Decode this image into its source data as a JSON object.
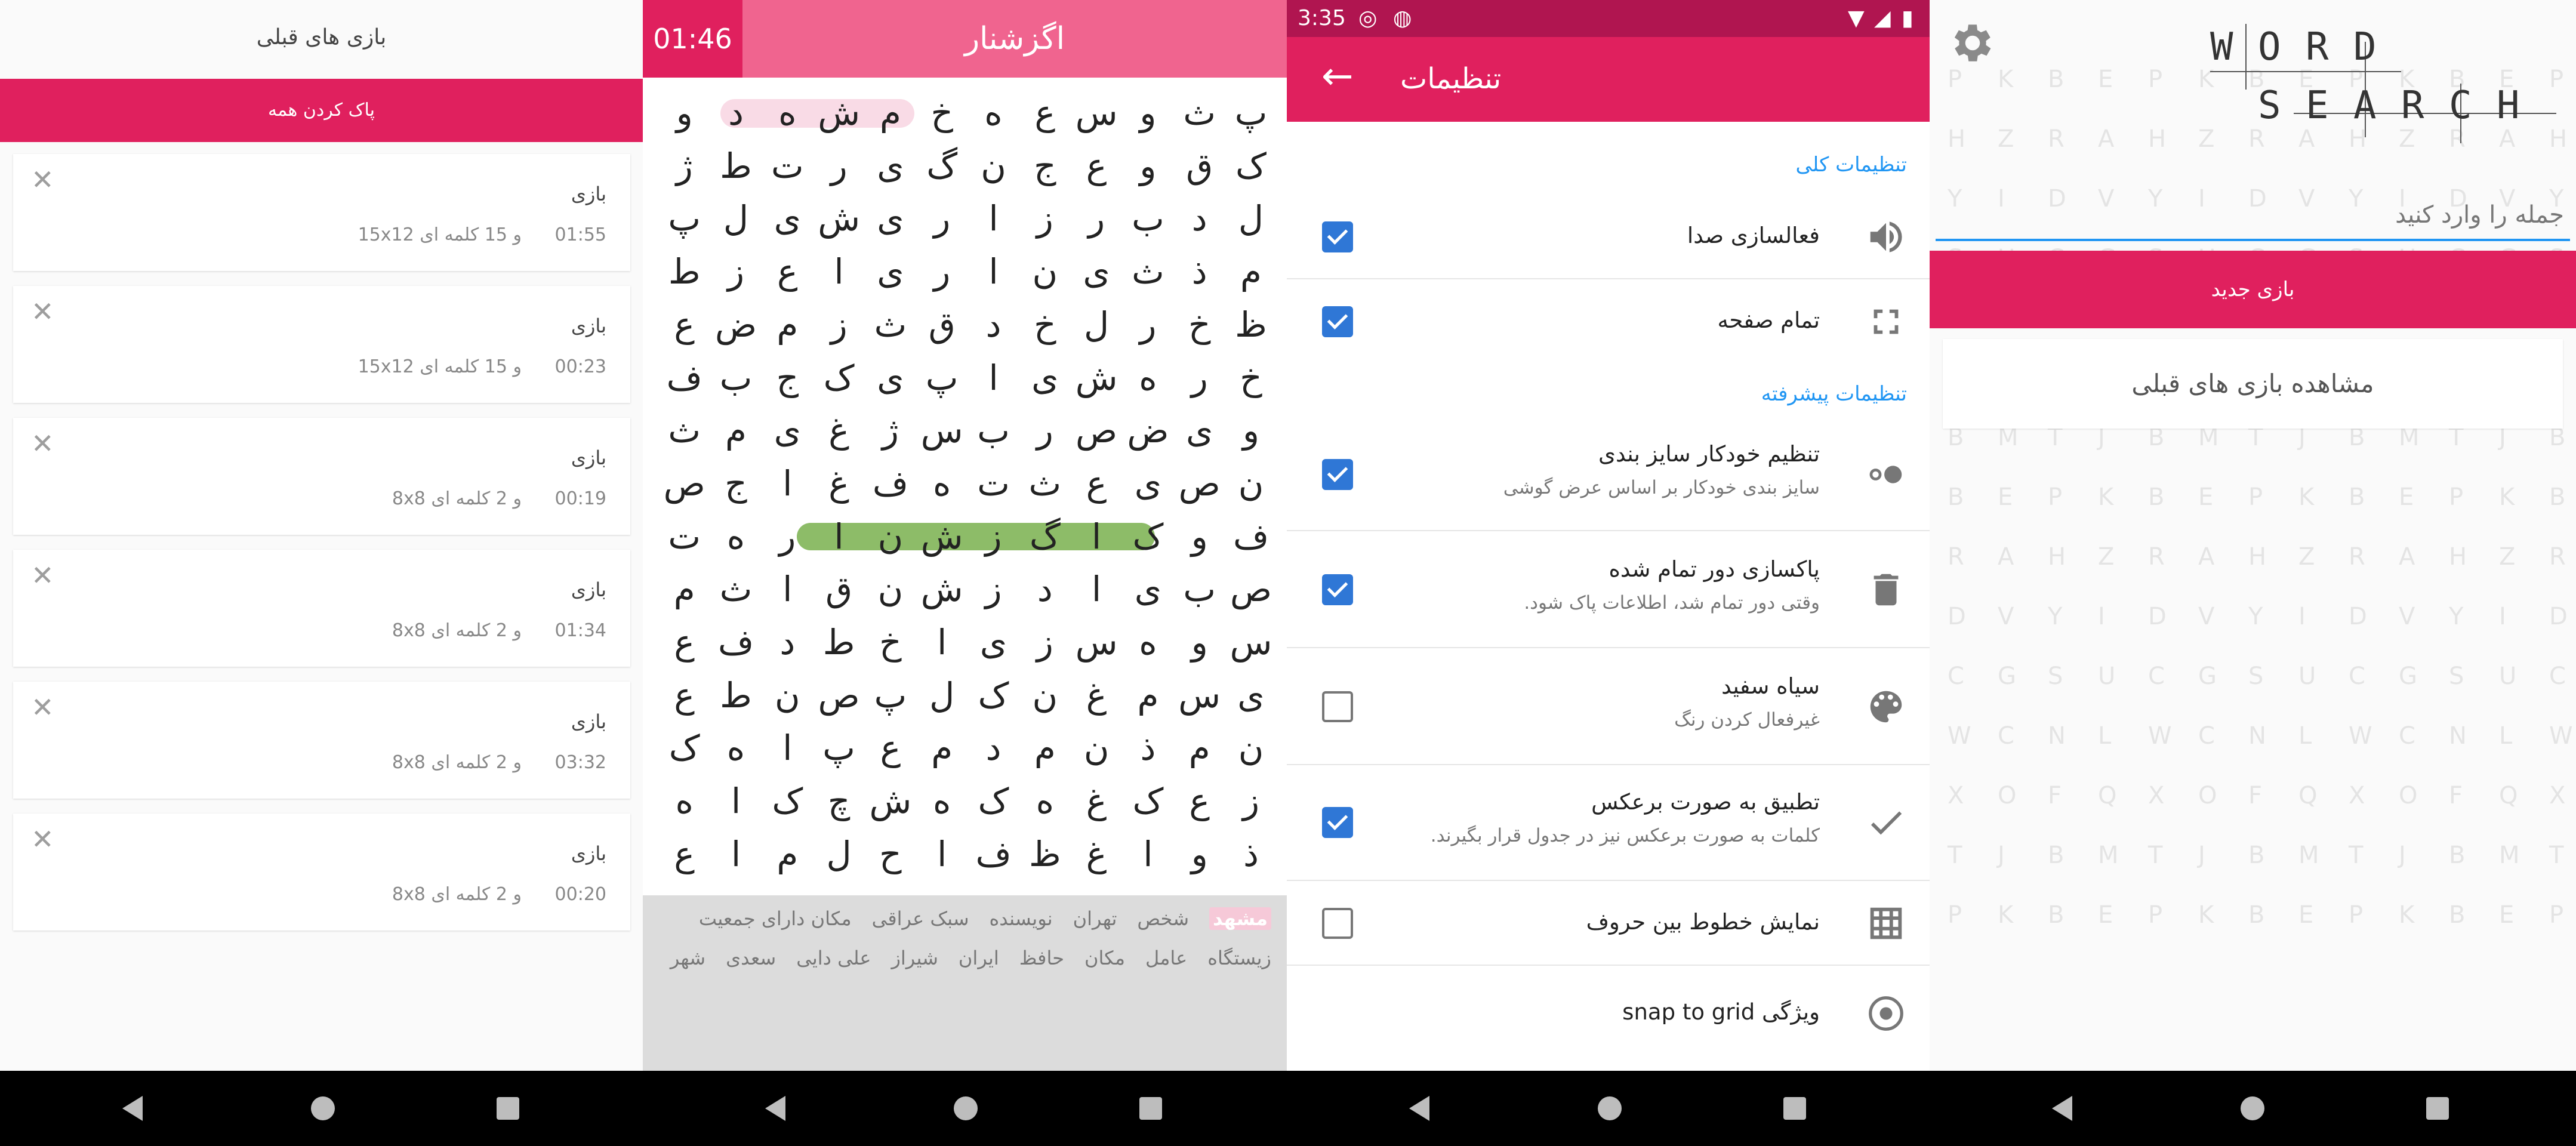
{
  "screen1": {
    "title": "بازی های قبلی",
    "clear_all": "پاک کردن همه",
    "close_glyph": "✕",
    "games": [
      {
        "name": "بازی",
        "time": "01:55",
        "desc": "و 15 کلمه ای 15x12"
      },
      {
        "name": "بازی",
        "time": "00:23",
        "desc": "و 15 کلمه ای 15x12"
      },
      {
        "name": "بازی",
        "time": "00:19",
        "desc": "و 2 کلمه ای 8x8"
      },
      {
        "name": "بازی",
        "time": "01:34",
        "desc": "و 2 کلمه ای 8x8"
      },
      {
        "name": "بازی",
        "time": "03:32",
        "desc": "و 2 کلمه ای 8x8"
      },
      {
        "name": "بازی",
        "time": "00:20",
        "desc": "و 2 کلمه ای 8x8"
      }
    ]
  },
  "screen2": {
    "timer": "01:46",
    "current_word": "اگزشنار",
    "grid": [
      [
        "پ",
        "ث",
        "و",
        "س",
        "ع",
        "ه",
        "خ",
        "م",
        "ش",
        "ه",
        "د",
        "و"
      ],
      [
        "ک",
        "ق",
        "و",
        "ع",
        "ج",
        "ن",
        "گ",
        "ی",
        "ر",
        "ت",
        "ط",
        "ژ"
      ],
      [
        "ل",
        "د",
        "ب",
        "ر",
        "ز",
        "ا",
        "ر",
        "ی",
        "ش",
        "ی",
        "ل",
        "پ"
      ],
      [
        "م",
        "ذ",
        "ث",
        "ی",
        "ن",
        "ا",
        "ر",
        "ی",
        "ا",
        "ع",
        "ز",
        "ط"
      ],
      [
        "ظ",
        "خ",
        "ر",
        "ل",
        "خ",
        "د",
        "ق",
        "ث",
        "ز",
        "م",
        "ض",
        "ع"
      ],
      [
        "خ",
        "ر",
        "ه",
        "ش",
        "ی",
        "ا",
        "پ",
        "ی",
        "ک",
        "ج",
        "ب",
        "ف"
      ],
      [
        "و",
        "ی",
        "ض",
        "ص",
        "ر",
        "ب",
        "س",
        "ژ",
        "غ",
        "ی",
        "م",
        "ث"
      ],
      [
        "ن",
        "ص",
        "ی",
        "ع",
        "ث",
        "ت",
        "ه",
        "ف",
        "غ",
        "ا",
        "ج",
        "ص"
      ],
      [
        "ف",
        "و",
        "ک",
        "ا",
        "گ",
        "ز",
        "ش",
        "ن",
        "ا",
        "ر",
        "ه",
        "ت"
      ],
      [
        "ص",
        "ب",
        "ی",
        "ا",
        "د",
        "ز",
        "ش",
        "ن",
        "ق",
        "ا",
        "ث",
        "م"
      ],
      [
        "س",
        "و",
        "ه",
        "س",
        "ز",
        "ی",
        "ا",
        "خ",
        "ط",
        "د",
        "ف",
        "ع"
      ],
      [
        "ی",
        "س",
        "م",
        "غ",
        "ن",
        "ک",
        "ل",
        "پ",
        "ص",
        "ن",
        "ط",
        "ع"
      ],
      [
        "ن",
        "م",
        "ذ",
        "ن",
        "م",
        "د",
        "م",
        "ع",
        "پ",
        "ا",
        "ه",
        "ک"
      ],
      [
        "ز",
        "ع",
        "ک",
        "غ",
        "ه",
        "ک",
        "ه",
        "ش",
        "چ",
        "ک",
        "ا",
        "ه"
      ],
      [
        "ذ",
        "و",
        "ا",
        "غ",
        "ظ",
        "ف",
        "ا",
        "ح",
        "ل",
        "م",
        "ا",
        "ع"
      ]
    ],
    "words_row1": [
      {
        "text": "مشهد",
        "found": true
      },
      {
        "text": "شخص",
        "found": false
      },
      {
        "text": "تهران",
        "found": false
      },
      {
        "text": "نویسنده",
        "found": false
      },
      {
        "text": "سبک عراقی",
        "found": false
      },
      {
        "text": "مکان دارای جمعیت",
        "found": false
      }
    ],
    "words_row2": [
      {
        "text": "زیستگاه",
        "found": false
      },
      {
        "text": "عامل",
        "found": false
      },
      {
        "text": "مکان",
        "found": false
      },
      {
        "text": "حافظ",
        "found": false
      },
      {
        "text": "ایران",
        "found": false
      },
      {
        "text": "شیراز",
        "found": false
      },
      {
        "text": "علی دایی",
        "found": false
      },
      {
        "text": "سعدی",
        "found": false
      },
      {
        "text": "شهر",
        "found": false
      }
    ]
  },
  "screen3": {
    "status_time": "3:35",
    "title": "تنظیمات",
    "section_general": "تنظیمات کلی",
    "section_advanced": "تنظیمات پیشرفته",
    "items": [
      {
        "title": "فعالسازی صدا",
        "subtitle": "",
        "checked": true,
        "icon": "volume-icon"
      },
      {
        "title": "تمام صفحه",
        "subtitle": "",
        "checked": true,
        "icon": "fullscreen-icon"
      },
      {
        "title": "تنظیم خودکار سایز بندی",
        "subtitle": "سایز بندی خودکار بر اساس عرض گوشی",
        "checked": true,
        "icon": "toggle-icon"
      },
      {
        "title": "پاکسازی دور تمام شده",
        "subtitle": "وقتی دور تمام شد، اطلاعات پاک شود.",
        "checked": true,
        "icon": "trash-icon"
      },
      {
        "title": "سیاه سفید",
        "subtitle": "غیرفعال کردن رنگ",
        "checked": false,
        "icon": "palette-icon"
      },
      {
        "title": "تطبیق به صورت برعکس",
        "subtitle": "کلمات به صورت برعکس نیز در جدول قرار بگیرند.",
        "checked": true,
        "icon": "check-icon"
      },
      {
        "title": "نمایش خطوط بین حروف",
        "subtitle": "",
        "checked": false,
        "icon": "grid-icon"
      },
      {
        "title": "ویژگی snap to grid",
        "subtitle": "",
        "checked": null,
        "icon": "target-icon"
      }
    ]
  },
  "screen4": {
    "logo_row1": "WORD",
    "logo_row2": "SEARCH",
    "input_placeholder": "جمله را وارد کنید",
    "new_game": "بازی جدید",
    "view_previous": "مشاهده بازی های قبلی",
    "bg_letters": "PQSABCDKXUHMNVBOCZTLYEFGRJWI"
  },
  "colors": {
    "accent": "#e0205e",
    "accent_light": "#f0648f",
    "status_dark": "#b01550",
    "checkbox": "#2f77d6",
    "found_word": "#8dbc68",
    "partial_word": "#f9dbe6",
    "link_blue": "#2196f3"
  }
}
